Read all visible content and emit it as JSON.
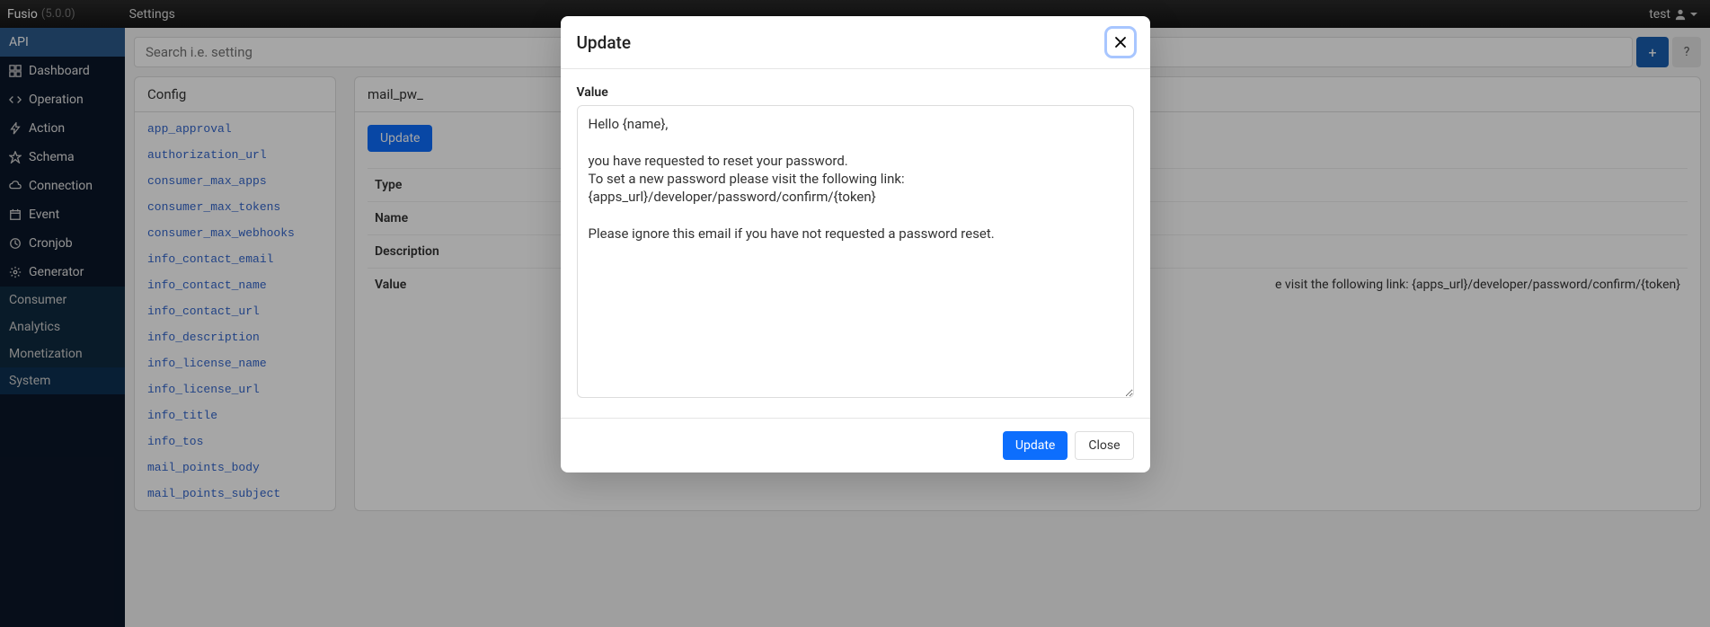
{
  "navbar": {
    "brand": "Fusio",
    "version": "(5.0.0)",
    "settings": "Settings",
    "user": "test"
  },
  "sidebar": {
    "api_header": "API",
    "items": [
      {
        "label": "Dashboard",
        "icon": "dashboard"
      },
      {
        "label": "Operation",
        "icon": "operation"
      },
      {
        "label": "Action",
        "icon": "action"
      },
      {
        "label": "Schema",
        "icon": "schema"
      },
      {
        "label": "Connection",
        "icon": "connection"
      },
      {
        "label": "Event",
        "icon": "event"
      },
      {
        "label": "Cronjob",
        "icon": "cronjob"
      },
      {
        "label": "Generator",
        "icon": "generator"
      }
    ],
    "consumer": "Consumer",
    "analytics": "Analytics",
    "monetization": "Monetization",
    "system": "System"
  },
  "search": {
    "placeholder": "Search i.e. setting",
    "add_label": "+",
    "help_label": "?"
  },
  "config_panel": {
    "header": "Config",
    "items": [
      "app_approval",
      "authorization_url",
      "consumer_max_apps",
      "consumer_max_tokens",
      "consumer_max_webhooks",
      "info_contact_email",
      "info_contact_name",
      "info_contact_url",
      "info_description",
      "info_license_name",
      "info_license_url",
      "info_title",
      "info_tos",
      "mail_points_body",
      "mail_points_subject"
    ]
  },
  "detail": {
    "header": "mail_pw_",
    "update_btn": "Update",
    "rows": {
      "type_label": "Type",
      "name_label": "Name",
      "desc_label": "Description",
      "value_label": "Value",
      "value_content": "e visit the following link: {apps_url}/developer/password/confirm/{token}"
    }
  },
  "modal": {
    "title": "Update",
    "value_label": "Value",
    "value_content": "Hello {name},\n\nyou have requested to reset your password.\nTo set a new password please visit the following link:\n{apps_url}/developer/password/confirm/{token}\n\nPlease ignore this email if you have not requested a password reset.",
    "update_btn": "Update",
    "close_btn": "Close"
  }
}
